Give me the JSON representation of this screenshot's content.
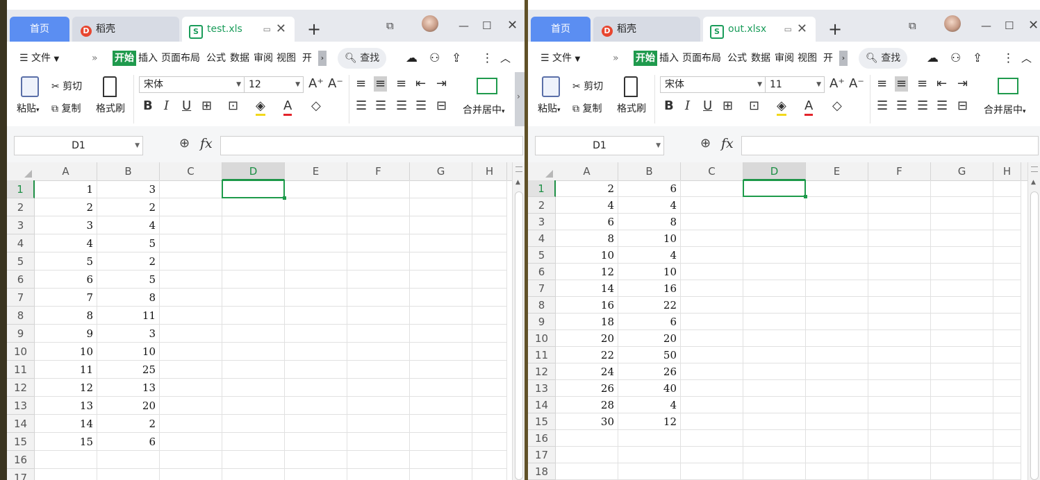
{
  "windows": [
    {
      "id": "left",
      "tabs": {
        "home": "首页",
        "daoke": "稻壳",
        "file": "test.xls"
      },
      "menu": {
        "file": "文件",
        "items": [
          "开始",
          "插入",
          "页面布局",
          "公式",
          "数据",
          "审阅",
          "视图",
          "开发"
        ],
        "search": "查找"
      },
      "ribbon": {
        "paste": "粘贴",
        "cut": "剪切",
        "copy": "复制",
        "format_painter": "格式刷",
        "font": "宋体",
        "size": "12",
        "merge": "合并居中"
      },
      "name_box": "D1",
      "columns": [
        "A",
        "B",
        "C",
        "D",
        "E",
        "F",
        "G",
        "H"
      ],
      "selected_col": "D",
      "rows": [
        "1",
        "2",
        "3",
        "4",
        "5",
        "6",
        "7",
        "8",
        "9",
        "10",
        "11",
        "12",
        "13",
        "14",
        "15",
        "16",
        "17"
      ],
      "data": [
        [
          1,
          3
        ],
        [
          2,
          2
        ],
        [
          3,
          4
        ],
        [
          4,
          5
        ],
        [
          5,
          2
        ],
        [
          6,
          5
        ],
        [
          7,
          8
        ],
        [
          8,
          11
        ],
        [
          9,
          3
        ],
        [
          10,
          10
        ],
        [
          11,
          25
        ],
        [
          12,
          13
        ],
        [
          13,
          20
        ],
        [
          14,
          2
        ],
        [
          15,
          6
        ]
      ]
    },
    {
      "id": "right",
      "tabs": {
        "home": "首页",
        "daoke": "稻壳",
        "file": "out.xlsx"
      },
      "menu": {
        "file": "文件",
        "items": [
          "开始",
          "插入",
          "页面布局",
          "公式",
          "数据",
          "审阅",
          "视图",
          "开发"
        ],
        "search": "查找"
      },
      "ribbon": {
        "paste": "粘贴",
        "cut": "剪切",
        "copy": "复制",
        "format_painter": "格式刷",
        "font": "宋体",
        "size": "11",
        "merge": "合并居中"
      },
      "name_box": "D1",
      "columns": [
        "A",
        "B",
        "C",
        "D",
        "E",
        "F",
        "G",
        "H"
      ],
      "selected_col": "D",
      "rows": [
        "1",
        "2",
        "3",
        "4",
        "5",
        "6",
        "7",
        "8",
        "9",
        "10",
        "11",
        "12",
        "13",
        "14",
        "15",
        "16",
        "17",
        "18"
      ],
      "data": [
        [
          2,
          6
        ],
        [
          4,
          4
        ],
        [
          6,
          8
        ],
        [
          8,
          10
        ],
        [
          10,
          4
        ],
        [
          12,
          10
        ],
        [
          14,
          16
        ],
        [
          16,
          22
        ],
        [
          18,
          6
        ],
        [
          20,
          20
        ],
        [
          22,
          50
        ],
        [
          24,
          26
        ],
        [
          26,
          40
        ],
        [
          28,
          4
        ],
        [
          30,
          12
        ]
      ]
    }
  ]
}
